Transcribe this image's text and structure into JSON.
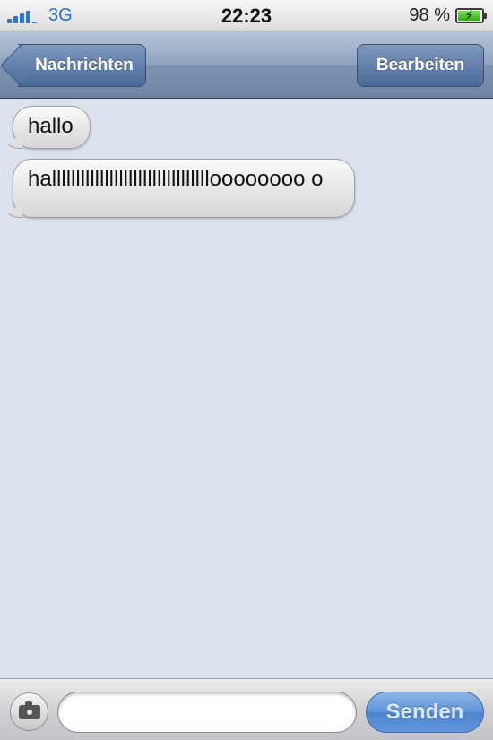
{
  "status_bar": {
    "network": "3G",
    "time": "22:23",
    "battery_percent": "98 %",
    "battery_level": 0.98,
    "signal_bars": 4
  },
  "nav": {
    "back_label": "Nachrichten",
    "edit_label": "Bearbeiten"
  },
  "messages": [
    {
      "text": "hallo",
      "direction": "incoming"
    },
    {
      "text": "hallllllllllllllllllllllllllllllllloooooooo o",
      "direction": "incoming"
    }
  ],
  "composer": {
    "input_value": "",
    "input_placeholder": "",
    "send_label": "Senden"
  },
  "icons": {
    "camera": "camera-icon",
    "back": "chevron-left-icon",
    "battery": "battery-charging-icon",
    "signal": "signal-icon"
  },
  "colors": {
    "background": "#dbe2ed",
    "nav_bar": "#7d93b2",
    "send_button": "#5d93d6",
    "accent": "#2c6fcf"
  }
}
